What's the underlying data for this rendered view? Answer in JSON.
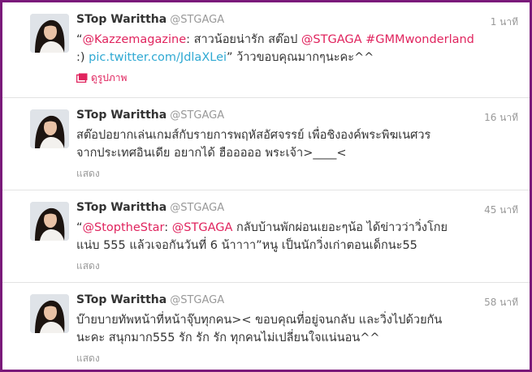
{
  "tweets": [
    {
      "name": "STop Warittha",
      "handle": "@STGAGA",
      "time": "1 นาที",
      "text": {
        "q": "“",
        "mention1": "@Kazzemagazine",
        "p1": ": สาวน้อยน่ารัก สต๊อป ",
        "mention2": "@STGAGA",
        "sp": " ",
        "hashtag": "#GMMwonderland",
        "p2": ":) ",
        "link": "pic.twitter.com/JdlaXLei",
        "p3": "” ว้าวขอบคุณมากๆนะคะ^^"
      },
      "action": "ดูรูปภาพ"
    },
    {
      "name": "STop Warittha",
      "handle": "@STGAGA",
      "time": "16 นาที",
      "text": {
        "line1": "สต๊อปอยากเล่นเกมส์กับรายการพฤหัสอัศจรรย์ เพื่อชิงองค์พระพิฆเนศวร",
        "line2": "จากประเทศอินเดีย อยากได้ ฮือออออ พระเจ้า>____<"
      },
      "action": "แสดง"
    },
    {
      "name": "STop Warittha",
      "handle": "@STGAGA",
      "time": "45 นาที",
      "text": {
        "q": "“",
        "mention1": "@StoptheStar",
        "p1": ": ",
        "mention2": "@STGAGA",
        "p2": " กลับบ้านพักผ่อนเยอะๆน้อ ได้ข่าวว่าวิ่งโกย",
        "line2": "แน่บ 555 แล้วเจอกันวันที่ 6 น้าาาา”หนู เป็นนักวิ่งเก่าตอนเด็กนะ55"
      },
      "action": "แสดง"
    },
    {
      "name": "STop Warittha",
      "handle": "@STGAGA",
      "time": "58 นาที",
      "text": {
        "line1": "บ๊ายบายทัพหน้าที่หน้าจุ๊บทุกคน>< ขอบคุณที่อยู่จนกลับ และวิ่งไปด้วยกัน",
        "line2": "นะคะ สนุกมาก555 รัก รัก รัก ทุกคนไม่เปลี่ยนใจแน่นอน^^"
      },
      "action": "แสดง"
    }
  ],
  "colors": {
    "frame": "#7a1a7a",
    "link": "#2fa9d3",
    "mention": "#e0245e"
  }
}
